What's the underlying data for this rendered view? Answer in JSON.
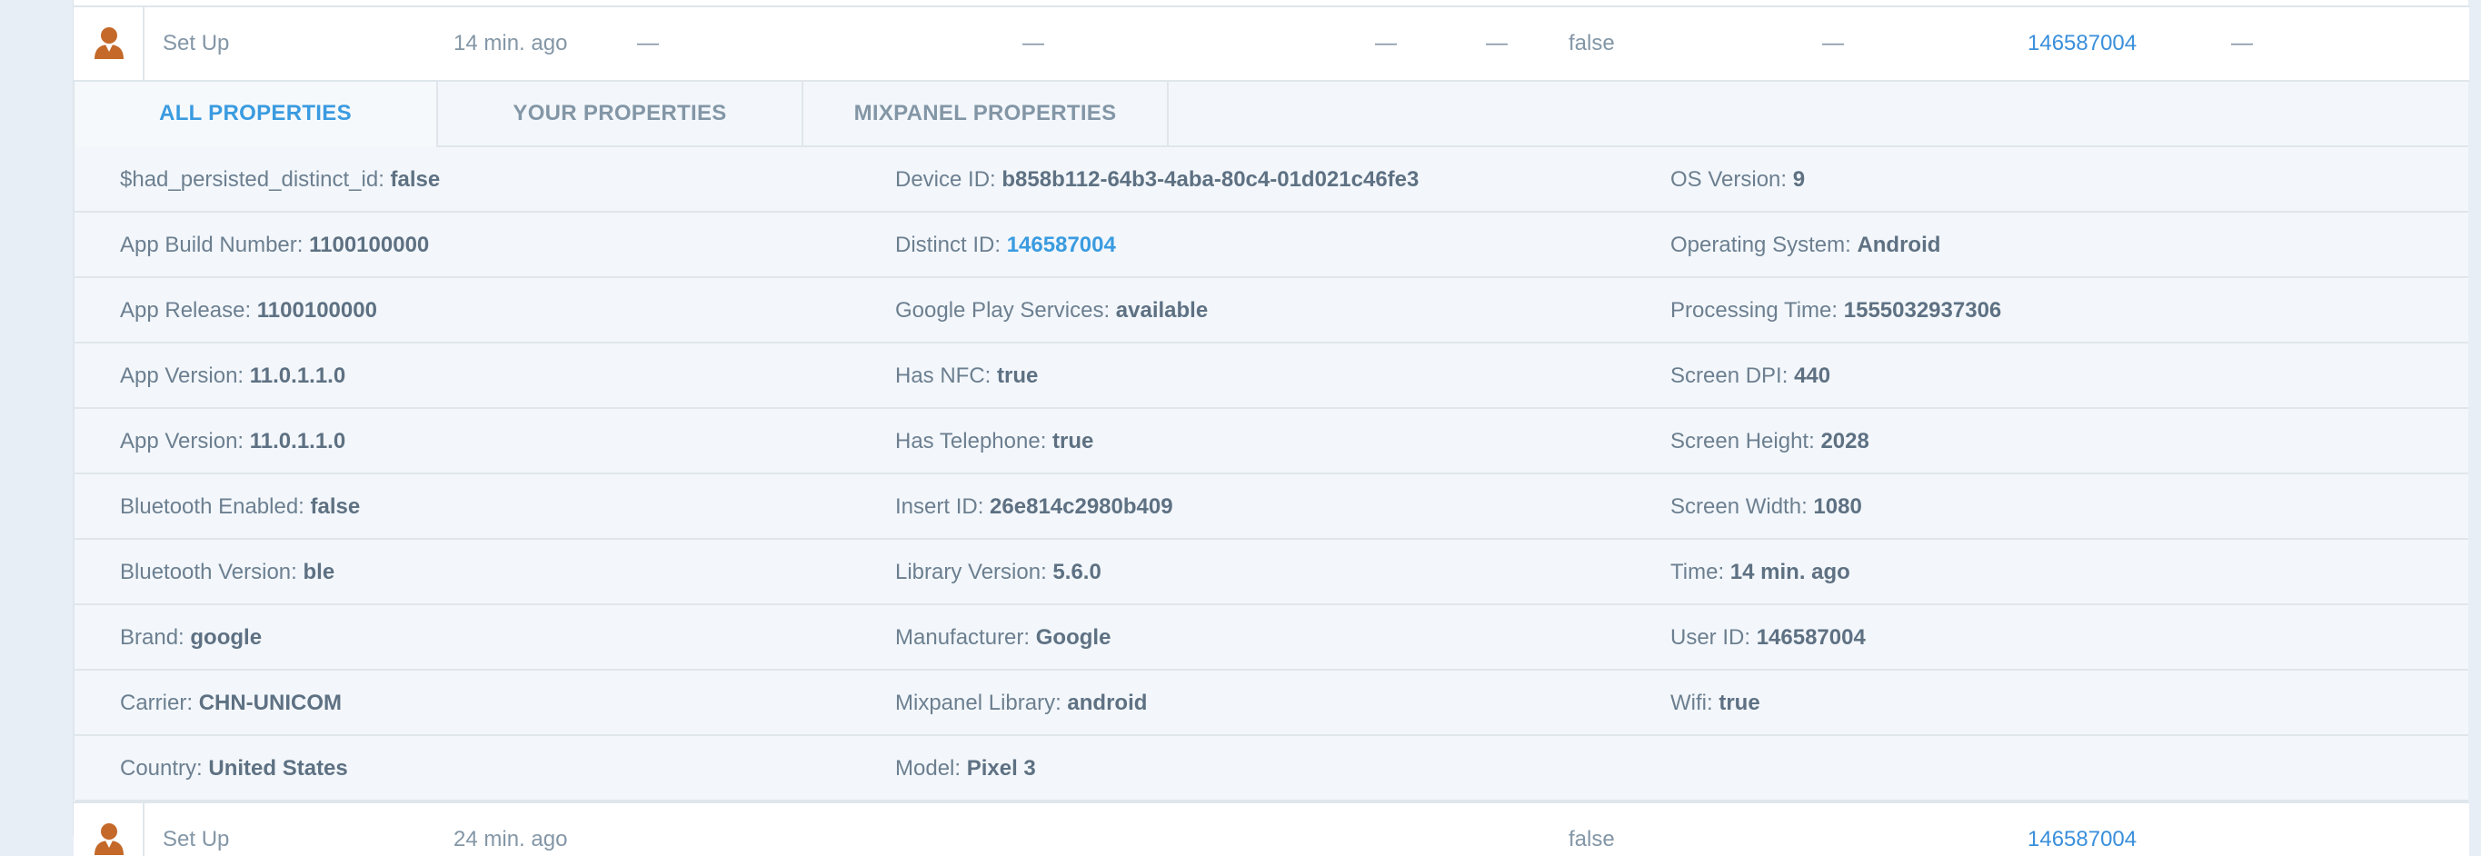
{
  "event_row": {
    "event_name": "Set Up",
    "time": "14 min. ago",
    "col3": "—",
    "col4": "—",
    "col5": "—",
    "col6": "—",
    "col7": "false",
    "col8": "—",
    "distinct_id": "146587004",
    "col10": "—"
  },
  "next_event_row": {
    "event_name": "Set Up",
    "time": "24 min. ago",
    "col7": "false",
    "distinct_id": "146587004"
  },
  "tabs": [
    {
      "label": "ALL PROPERTIES",
      "active": true
    },
    {
      "label": "YOUR PROPERTIES",
      "active": false
    },
    {
      "label": "MIXPANEL PROPERTIES",
      "active": false
    }
  ],
  "properties": {
    "col1": [
      {
        "key": "$had_persisted_distinct_id",
        "value": "false"
      },
      {
        "key": "App Build Number",
        "value": "1100100000"
      },
      {
        "key": "App Release",
        "value": "1100100000"
      },
      {
        "key": "App Version",
        "value": "11.0.1.1.0"
      },
      {
        "key": "App Version",
        "value": "11.0.1.1.0"
      },
      {
        "key": "Bluetooth Enabled",
        "value": "false"
      },
      {
        "key": "Bluetooth Version",
        "value": "ble"
      },
      {
        "key": "Brand",
        "value": "google"
      },
      {
        "key": "Carrier",
        "value": "CHN-UNICOM"
      },
      {
        "key": "Country",
        "value": "United States"
      }
    ],
    "col2": [
      {
        "key": "Device ID",
        "value": "b858b112-64b3-4aba-80c4-01d021c46fe3"
      },
      {
        "key": "Distinct ID",
        "value": "146587004",
        "link": true
      },
      {
        "key": "Google Play Services",
        "value": "available"
      },
      {
        "key": "Has NFC",
        "value": "true"
      },
      {
        "key": "Has Telephone",
        "value": "true"
      },
      {
        "key": "Insert ID",
        "value": "26e814c2980b409"
      },
      {
        "key": "Library Version",
        "value": "5.6.0"
      },
      {
        "key": "Manufacturer",
        "value": "Google"
      },
      {
        "key": "Mixpanel Library",
        "value": "android"
      },
      {
        "key": "Model",
        "value": "Pixel 3"
      }
    ],
    "col3": [
      {
        "key": "OS Version",
        "value": "9"
      },
      {
        "key": "Operating System",
        "value": "Android"
      },
      {
        "key": "Processing Time",
        "value": "1555032937306"
      },
      {
        "key": "Screen DPI",
        "value": "440"
      },
      {
        "key": "Screen Height",
        "value": "2028"
      },
      {
        "key": "Screen Width",
        "value": "1080"
      },
      {
        "key": "Time",
        "value": "14 min. ago"
      },
      {
        "key": "User ID",
        "value": "146587004"
      },
      {
        "key": "Wifi",
        "value": "true"
      }
    ]
  },
  "colors": {
    "link": "#3a9be0",
    "avatar": "#c4692a",
    "border": "#dfe6ec",
    "panel_bg": "#f3f7fb"
  },
  "icons": {
    "avatar": "user-icon"
  }
}
